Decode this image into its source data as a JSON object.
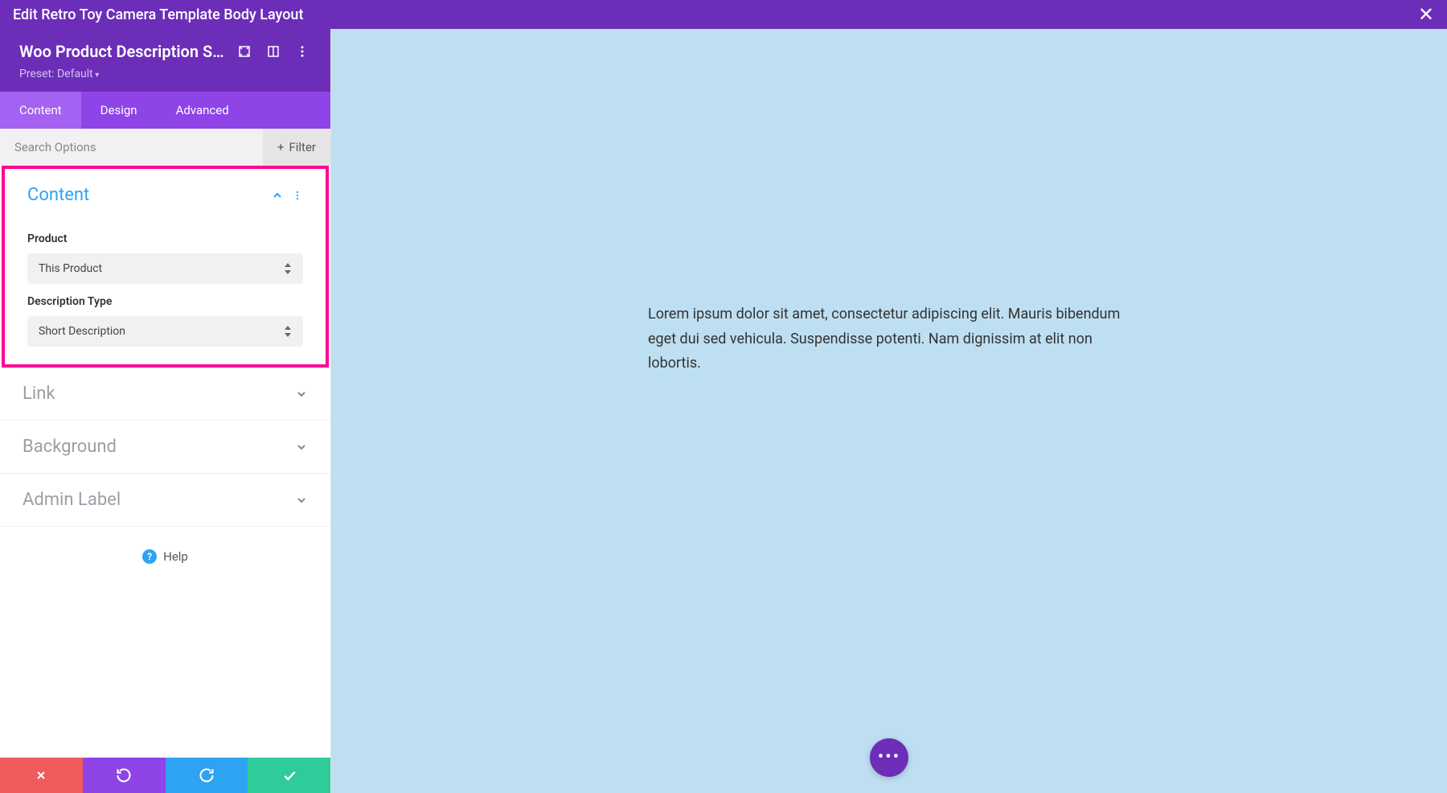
{
  "topbar": {
    "title": "Edit Retro Toy Camera Template Body Layout"
  },
  "module": {
    "title": "Woo Product Description S...",
    "preset": "Preset: Default"
  },
  "tabs": [
    {
      "label": "Content",
      "active": true
    },
    {
      "label": "Design",
      "active": false
    },
    {
      "label": "Advanced",
      "active": false
    }
  ],
  "search": {
    "placeholder": "Search Options",
    "filter_label": "Filter"
  },
  "sections": {
    "content": {
      "title": "Content",
      "fields": {
        "product": {
          "label": "Product",
          "value": "This Product"
        },
        "description_type": {
          "label": "Description Type",
          "value": "Short Description"
        }
      }
    },
    "link": {
      "title": "Link"
    },
    "background": {
      "title": "Background"
    },
    "admin_label": {
      "title": "Admin Label"
    }
  },
  "help": {
    "label": "Help"
  },
  "preview": {
    "text": "Lorem ipsum dolor sit amet, consectetur adipiscing elit. Mauris bibendum eget dui sed vehicula. Suspendisse potenti. Nam dignissim at elit non lobortis."
  }
}
